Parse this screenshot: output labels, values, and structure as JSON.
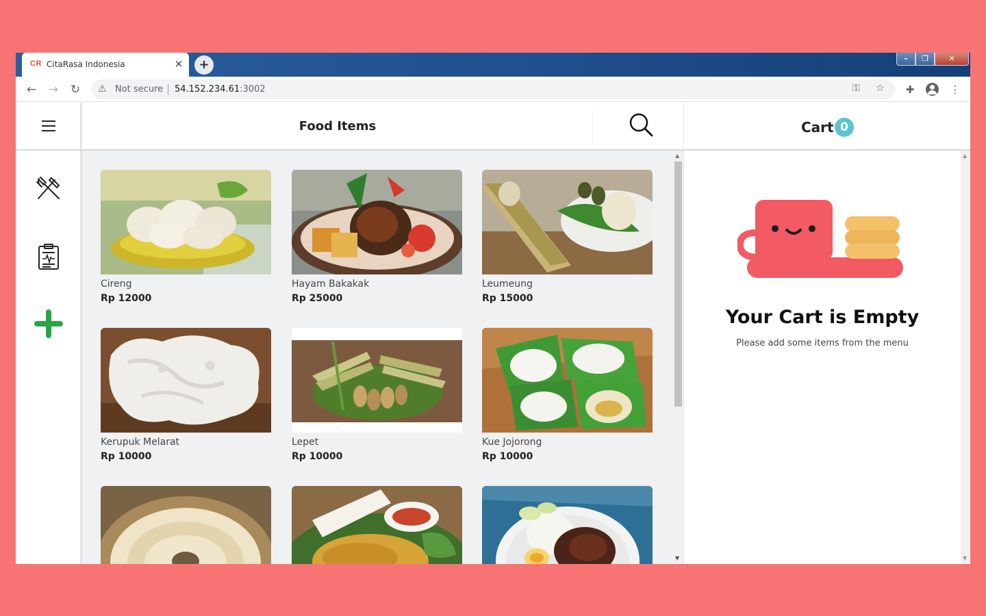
{
  "browser": {
    "tab_logo": "CR",
    "tab_title": "CitaRasa Indonesia",
    "tab_close": "×",
    "new_tab": "+",
    "security_label": "Not secure",
    "url_host": "54.152.234.61",
    "url_port": ":3002",
    "window_controls": {
      "minimize": "–",
      "maximize": "❐",
      "close": "✕"
    }
  },
  "header": {
    "title": "Food Items"
  },
  "sidebar": {
    "items": [
      {
        "icon": "utensils-icon"
      },
      {
        "icon": "clipboard-report-icon"
      },
      {
        "icon": "plus-icon"
      }
    ]
  },
  "food_items": [
    {
      "name": "Cireng",
      "price": "Rp 12000"
    },
    {
      "name": "Hayam Bakakak",
      "price": "Rp 25000"
    },
    {
      "name": "Leumeung",
      "price": "Rp 15000"
    },
    {
      "name": "Kerupuk Melarat",
      "price": "Rp 10000"
    },
    {
      "name": "Lepet",
      "price": "Rp 10000"
    },
    {
      "name": "Kue Jojorong",
      "price": "Rp 10000"
    },
    {
      "name": "",
      "price": ""
    },
    {
      "name": "",
      "price": ""
    },
    {
      "name": "",
      "price": ""
    }
  ],
  "cart": {
    "label": "Cart",
    "count": "0",
    "empty_title": "Your Cart is Empty",
    "empty_subtitle": "Please add some items from the menu"
  },
  "colors": {
    "background": "#f87474",
    "accent_green": "#2aa545",
    "cart_badge": "#5bc5cf",
    "cup_red": "#f25a64"
  }
}
